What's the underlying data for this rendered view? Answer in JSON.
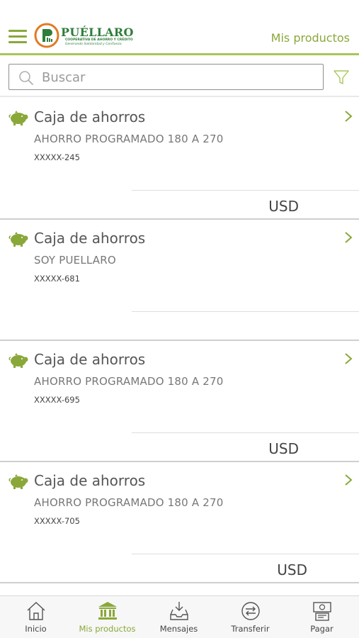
{
  "header": {
    "title": "Mis productos",
    "logo": {
      "name": "PUÉLLARO",
      "subtitle": "COOPERATIVA DE AHORRO Y CRÉDITO",
      "tagline": "Generando Solidaridad y Confianza"
    }
  },
  "search": {
    "placeholder": "Buscar"
  },
  "products": [
    {
      "type": "Caja de ahorros",
      "name": "AHORRO PROGRAMADO 180 A 270",
      "number": "XXXXX-245",
      "currency": "USD"
    },
    {
      "type": "Caja de ahorros",
      "name": "SOY PUELLARO",
      "number": "XXXXX-681",
      "currency": ""
    },
    {
      "type": "Caja de ahorros",
      "name": "AHORRO PROGRAMADO 180 A 270",
      "number": "XXXXX-695",
      "currency": "USD"
    },
    {
      "type": "Caja de ahorros",
      "name": "AHORRO PROGRAMADO 180 A 270",
      "number": "XXXXX-705",
      "currency": "USD"
    }
  ],
  "nav": {
    "items": [
      {
        "label": "Inicio",
        "icon": "home-icon"
      },
      {
        "label": "Mis productos",
        "icon": "bank-icon",
        "active": true
      },
      {
        "label": "Mensajes",
        "icon": "inbox-icon"
      },
      {
        "label": "Transferir",
        "icon": "transfer-icon"
      },
      {
        "label": "Pagar",
        "icon": "payment-icon"
      }
    ]
  },
  "colors": {
    "accent": "#8aa83a",
    "header_border": "#a8c65a",
    "logo_green": "#2e7d3a",
    "logo_orange": "#e07b24"
  }
}
